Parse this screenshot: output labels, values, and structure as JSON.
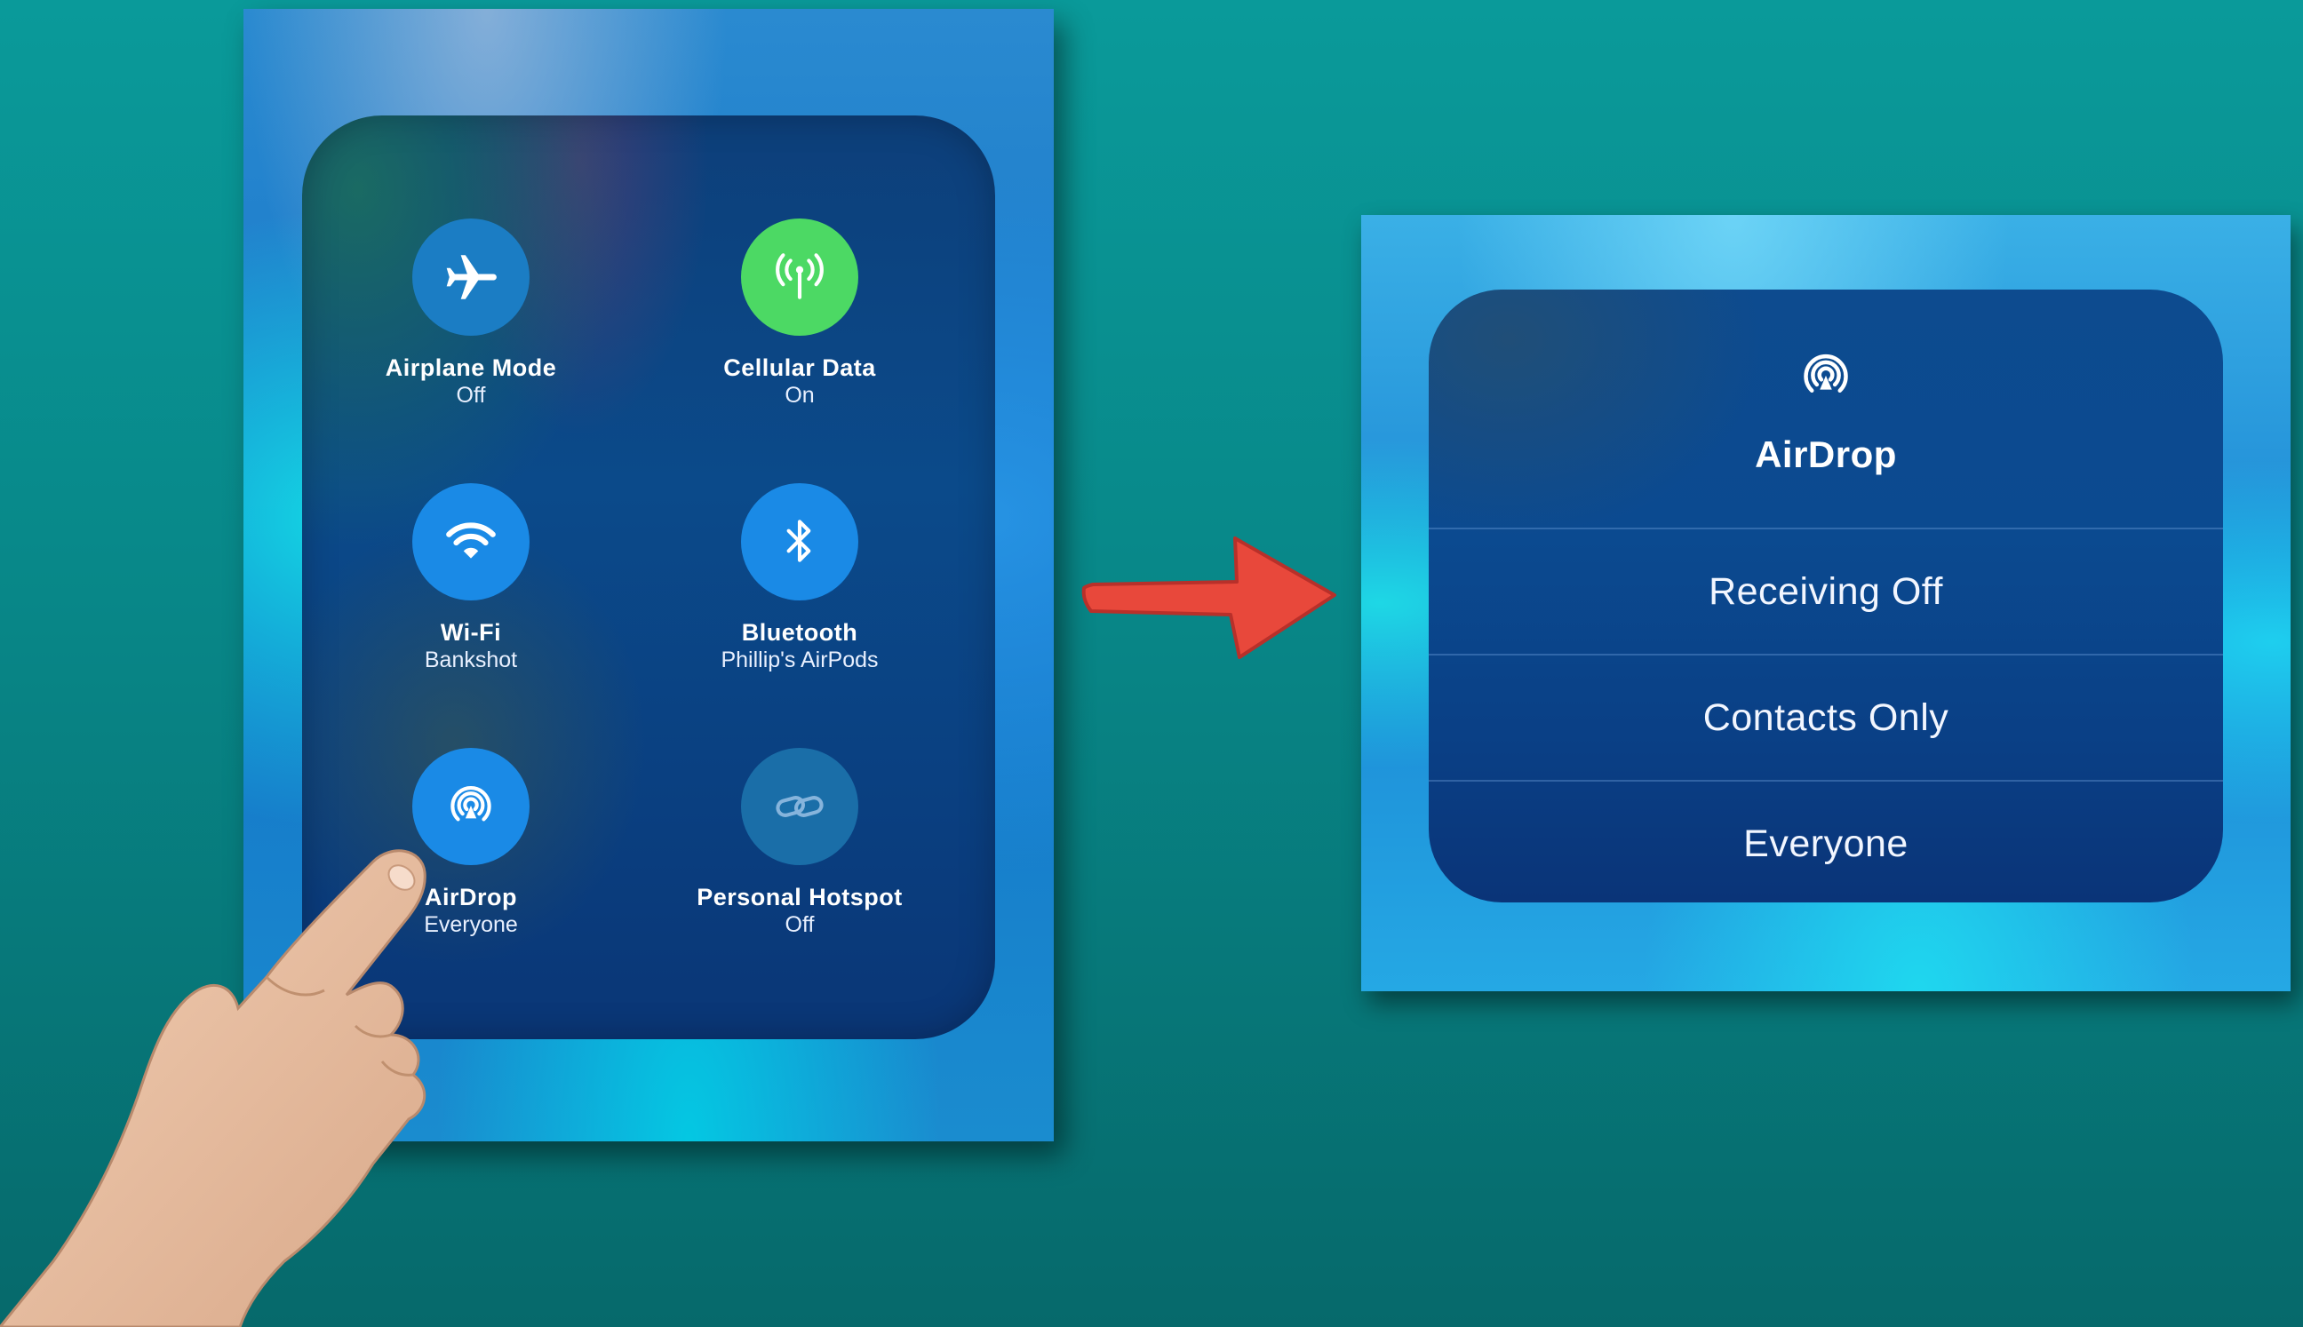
{
  "control_center": {
    "tiles": [
      {
        "icon": "airplane-icon",
        "label": "Airplane Mode",
        "status": "Off"
      },
      {
        "icon": "cellular-antenna-icon",
        "label": "Cellular Data",
        "status": "On"
      },
      {
        "icon": "wifi-icon",
        "label": "Wi-Fi",
        "status": "Bankshot"
      },
      {
        "icon": "bluetooth-icon",
        "label": "Bluetooth",
        "status": "Phillip's AirPods"
      },
      {
        "icon": "airdrop-icon",
        "label": "AirDrop",
        "status": "Everyone"
      },
      {
        "icon": "hotspot-icon",
        "label": "Personal Hotspot",
        "status": "Off"
      }
    ]
  },
  "airdrop_menu": {
    "icon": "airdrop-icon",
    "title": "AirDrop",
    "options": [
      "Receiving Off",
      "Contacts Only",
      "Everyone"
    ]
  },
  "colors": {
    "background": "#088788",
    "toggle_active_blue": "#1a8ae6",
    "toggle_active_green": "#4cd964",
    "arrow": "#e8483b"
  }
}
